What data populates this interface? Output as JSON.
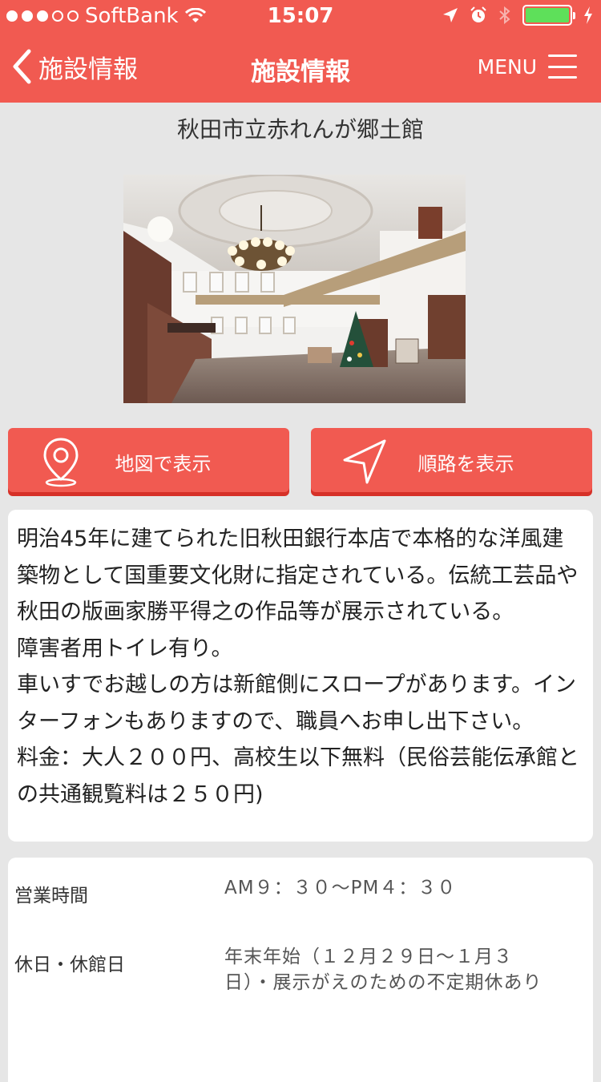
{
  "status_bar": {
    "carrier": "SoftBank",
    "time": "15:07"
  },
  "nav": {
    "back_label": "施設情報",
    "title": "施設情報",
    "menu_label": "MENU"
  },
  "facility": {
    "name": "秋田市立赤れんが郷土館"
  },
  "buttons": {
    "map_label": "地図で表示",
    "route_label": "順路を表示"
  },
  "description": {
    "paragraphs": [
      "明治45年に建てられた旧秋田銀行本店で本格的な洋風建築物として国重要文化財に指定されている。伝統工芸品や秋田の版画家勝平得之の作品等が展示されている。",
      "障害者用トイレ有り。",
      "車いすでお越しの方は新館側にスロープがあります。インターフォンもありますので、職員へお申し出下さい。",
      "料金：大人２００円、高校生以下無料（民俗芸能伝承館との共通観覧料は２５０円)"
    ]
  },
  "info": {
    "hours_label": "営業時間",
    "hours_value": "AM９：３０〜PM４：３０",
    "closed_label": "休日・休館日",
    "closed_value": "年末年始（１２月２９日〜１月３日）・展示がえのための不定期休あり"
  },
  "colors": {
    "accent": "#f15a51",
    "accent_shadow": "#d63128",
    "background": "#e6e6e6"
  }
}
